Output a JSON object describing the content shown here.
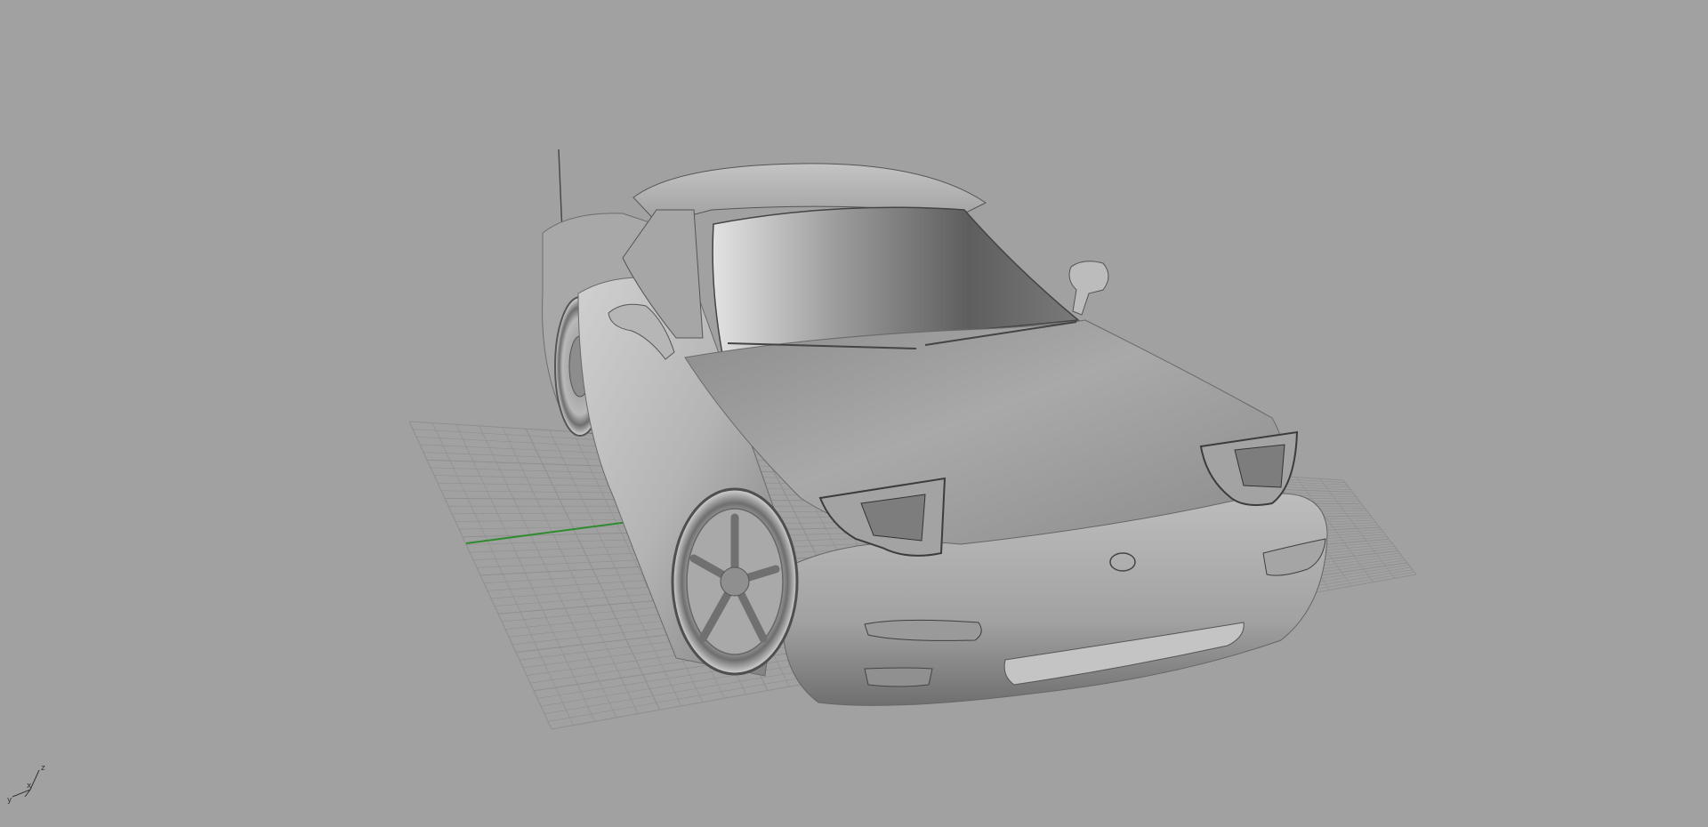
{
  "viewport": {
    "background": "#a1a1a1",
    "construction_plane": {
      "grid_color": "#8f8f8f",
      "x_axis_color": "#2e8b2e"
    },
    "model": {
      "shading": "shaded grey",
      "body_color": "#b8b8b8"
    },
    "axis_widget": {
      "z_label": "z",
      "x_label": "x",
      "y_label": "y"
    }
  }
}
